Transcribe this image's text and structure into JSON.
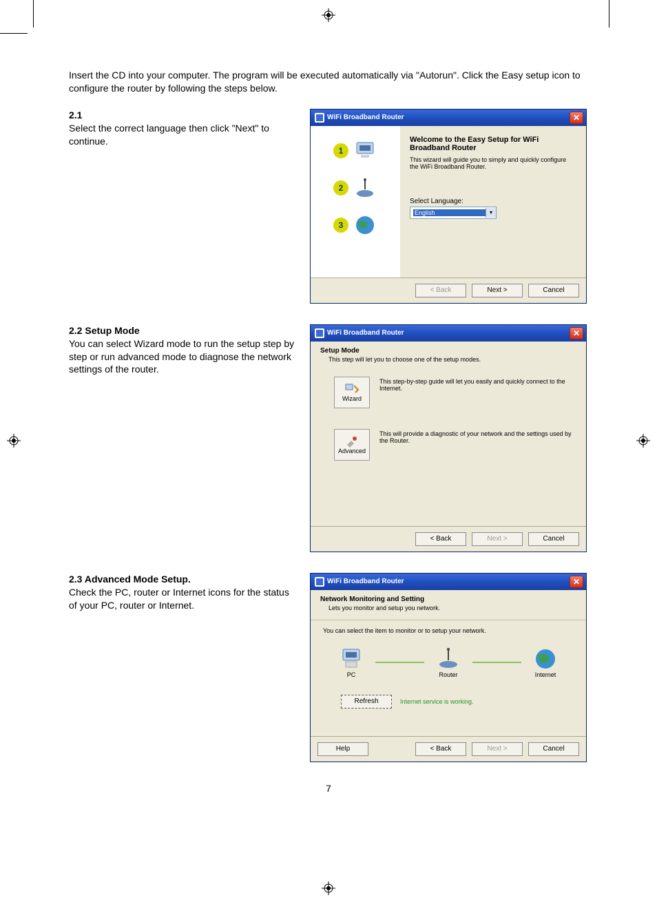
{
  "page_number": "7",
  "intro": "Insert the CD into your computer. The program will be executed automatically via \"Autorun\". Click the Easy setup icon to configure the router by following the steps below.",
  "sec1": {
    "heading": "2.1",
    "body": "Select the correct language then click \"Next\" to continue."
  },
  "sec2": {
    "heading": "2.2 Setup Mode",
    "body": "You can select Wizard mode to run the setup step by step or run advanced mode to diagnose the network settings of the router."
  },
  "sec3": {
    "heading": "2.3 Advanced Mode Setup.",
    "body": "Check the PC, router or Internet icons for the status of your PC, router or Internet."
  },
  "dlg1": {
    "title": "WiFi Broadband Router",
    "welcome": "Welcome to the Easy Setup for WiFi Broadband Router",
    "desc": "This wizard will guide you to simply and quickly configure the WiFi Broadband Router.",
    "steps": {
      "s1": "1",
      "s2": "2",
      "s3": "3"
    },
    "lang_label": "Select Language:",
    "lang_value": "English",
    "btn_back": "< Back",
    "btn_next": "Next >",
    "btn_cancel": "Cancel"
  },
  "dlg2": {
    "title": "WiFi Broadband Router",
    "heading": "Setup Mode",
    "sub": "This step will let you to choose one of the setup modes.",
    "wizard_label": "Wizard",
    "wizard_desc": "This step-by-step guide will let you easily and quickly connect to the Internet.",
    "adv_label": "Advanced",
    "adv_desc": "This will provide a diagnostic of your network and the settings used by the Router.",
    "btn_back": "< Back",
    "btn_next": "Next >",
    "btn_cancel": "Cancel"
  },
  "dlg3": {
    "title": "WiFi Broadband Router",
    "heading": "Network Monitoring and Setting",
    "sub": "Lets you monitor and setup you network.",
    "instr": "You can select the item to monitor or to setup your network.",
    "dev_pc": "PC",
    "dev_router": "Router",
    "dev_internet": "Internet",
    "btn_refresh": "Refresh",
    "status": "Internet service is working.",
    "btn_help": "Help",
    "btn_back": "< Back",
    "btn_next": "Next >",
    "btn_cancel": "Cancel"
  }
}
